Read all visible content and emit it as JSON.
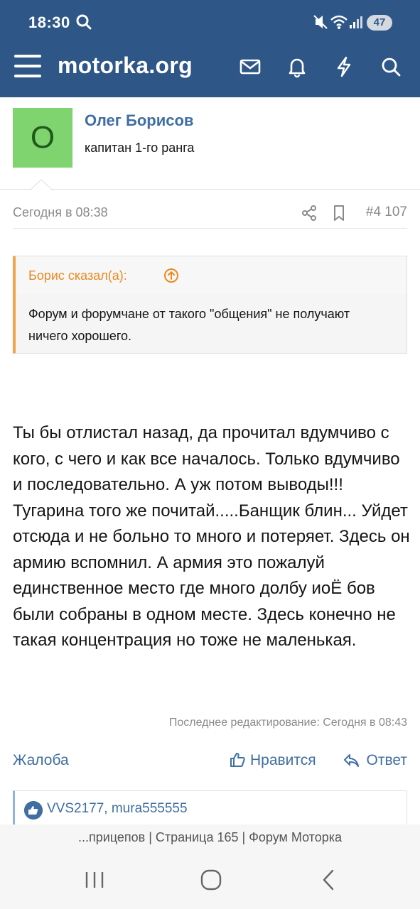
{
  "status_bar": {
    "time": "18:30",
    "battery": "47"
  },
  "header": {
    "logo": "motorka.org",
    "icons": [
      "menu-icon",
      "envelope-icon",
      "bell-icon",
      "lightning-icon",
      "search-icon"
    ]
  },
  "author": {
    "avatar_letter": "О",
    "avatar_color": "#7fd46f",
    "name": "Олег Борисов",
    "rank": "капитан 1-го ранга"
  },
  "post": {
    "date": "Сегодня в 08:38",
    "number": "#4 107",
    "quote": {
      "author": "Борис сказал(а):",
      "text": "Форум и форумчане от такого \"общения\" не получают ничего хорошего."
    },
    "body": "Ты бы отлистал назад, да прочитал вдумчиво с кого, с чего и как все началось. Только вдумчиво и последовательно. А уж потом выводы!!! Тугарина того же почитай.....Банщик блин... Уйдет отсюда и не больно то много и потеряет. Здесь он армию вспомнил. А армия это пожалуй единственное место где много долбу иоЁ бов были собраны в одном месте. Здесь конечно не такая концентрация но тоже не маленькая.",
    "edited": "Последнее редактирование: Сегодня в 08:43",
    "actions": {
      "report": "Жалоба",
      "like": "Нравится",
      "reply": "Ответ"
    },
    "reactions": "VVS2177, mura555555"
  },
  "browser": {
    "page_title": "...прицепов | Страница 165 | Форум Моторка"
  },
  "colors": {
    "brand_blue": "#2e5787",
    "link_blue": "#3f6ea3",
    "quote_accent": "#f3a34b"
  }
}
